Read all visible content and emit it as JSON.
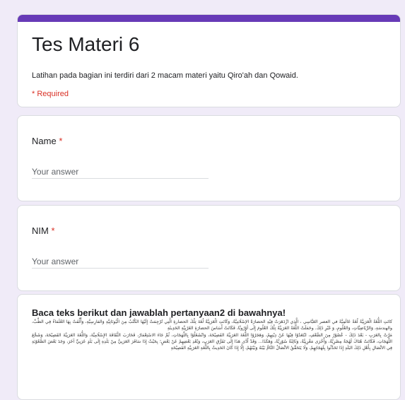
{
  "form": {
    "title": "Tes Materi 6",
    "description": "Latihan pada bagian ini terdiri dari 2 macam materi yaitu Qiro'ah dan Qowaid.",
    "required_note": "* Required",
    "accent_color": "#673ab7",
    "background_color": "#f0ebf8"
  },
  "questions": [
    {
      "label": "Name",
      "required_mark": "*",
      "placeholder": "Your answer"
    },
    {
      "label": "NIM",
      "required_mark": "*",
      "placeholder": "Your answer"
    }
  ],
  "passage": {
    "heading": "Baca teks berikut dan jawablah pertanyaan2 di bawahnya!",
    "paragraphs": [
      "كانَتِ اللُّغَةُ الْعَرَبِيَّةُ لُغَةً عَالَمِيَّةً في العصر العَبَّاسِي ، الَّذِي ازْدَهَرَتْ فِيْهِ الحضارَةُ الإسْلَامِيَّةُ، وَكَانَتِ الْعَرَبِيَّةُ لُغَةَ تِلْكَ الحضارةِ الَّتِي تُرْجِمَتْ إِلَيْهَا الكُتُبُ مِنَ الْيُونَانِيَّةِ وَالفارِسِيَّةِ، وَأُلِّفَتْ بِهَا العُلَمَاءُ فِي الطِّبِّ، والهندسَةِ، وَالرِّيَاضِيَّاتِ، وَالعُلُومِ، وَ غَيْرِ ذَلِكَ. وحَمَلَتْ اللُّغَةُ العَرَبِيَّةُ تِلْكَ العُلُومَ إِلَى أوْرُوبَّا، فَكَانَتْ أَسَاسَ الحضارَةِ الغَرْبِيَّةِ الحَدِيثَةِ",
      "مَرَّتْ بِالعَرَبِ - بَعْدَ ذَلِكَ - عُصُوْرٌ مِنَ الضَّعْفِ، ابْتَعَدُوْا فِيْهَا عَنْ دِيْنِهِمْ، وَهَجَرُوْا اللُّغَةَ العَرَبِيَّةَ الفَصِيْحَةَ، وَانْشَغَلُوْا بِاللَّهَجَاتِ، ثُمَّ جَاءَ الاسْتِعْمَارُ، فَحَارَبَ الثَّقَافَةَ الإِسْلَامِيَّةَ، وَاللُّغَةَ العَرَبِيَّةَ الفَصِيْحَةَ، وَشَجَّعَ اللَّهَجَاتِ، فَكَانَتْ هُنَاكَ لَهْجَةٌ مِصْرِيَّةٌ، وَأُخْرَى مَغْرِبِيَّةٌ، وَثَالِثَةٌ سُوْرِيَّةٌ، وَهَكَذَا... وَقَدْ أَدَّى هَذَا إِلَى تَفَرُّقِ العَرَبِ، وَبُعْدِ بَعْضِهِمْ عَنْ بَعْضٍ؛ بِحَيْثُ إِذَا سَافَرَ العَرَبِيُّ مِنْ بَلَدِهِ إِلَى بَلَدٍ عَرَبِيٍّ آخَرَ، وَجَدَ بَعْضَ الصُّعُوْبَةِ فِي الاتِّصَالِ بِأَهْلِ ذَلِكَ البَلَدِ إِذَا تَحَدَّثُوا بِلَهَجَاتِهِمْ، وَلَا يَتَحَقَّقُ الاتِّصَالُ التَّامُّ بَيْنَهُ وَبَيْنَهُمْ، إِلَّا إِذَا كَانَ الحَدِيثُ بِاللُّغَةِ العَرَبِيَّةِ الفَصِيْحَةِ"
    ]
  }
}
